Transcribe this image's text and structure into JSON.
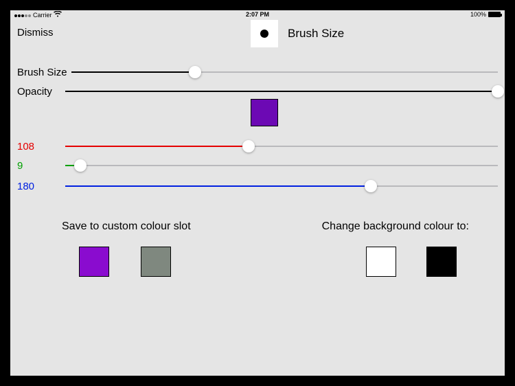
{
  "statusbar": {
    "carrier": "Carrier",
    "time": "2:07 PM",
    "battery_pct": "100%"
  },
  "header": {
    "dismiss": "Dismiss",
    "preview_label": "Brush Size"
  },
  "sliders": {
    "brush": {
      "label": "Brush Size",
      "value": 0.29,
      "fill": "#000"
    },
    "opacity": {
      "label": "Opacity",
      "value": 1.0,
      "fill": "#000"
    },
    "red": {
      "label": "108",
      "value": 0.4235,
      "color": "#e50000"
    },
    "green": {
      "label": "9",
      "value": 0.0353,
      "color": "#00a000"
    },
    "blue": {
      "label": "180",
      "value": 0.7059,
      "color": "#0020e0"
    }
  },
  "color_preview_hex": "#6c09b4",
  "sections": {
    "save_label": "Save to custom colour slot",
    "bg_label": "Change background colour to:"
  },
  "swatches": {
    "custom1": "#8a0ccf",
    "custom2": "#7f887f",
    "bg_white": "#ffffff",
    "bg_black": "#000000"
  }
}
